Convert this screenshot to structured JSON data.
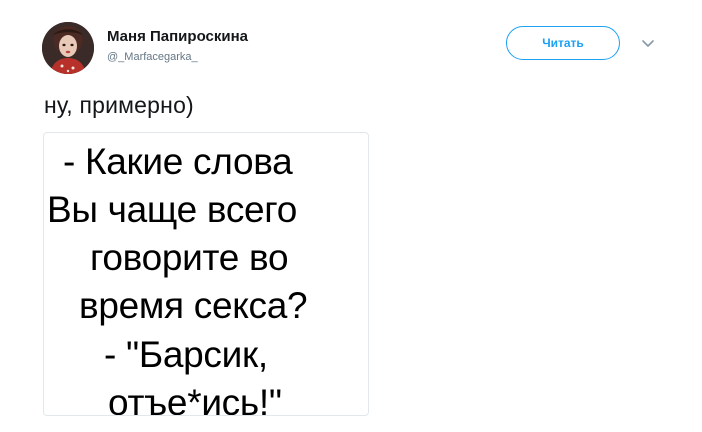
{
  "tweet": {
    "author": {
      "display_name": "Маня Папироскина",
      "username": "@_Marfacegarka_"
    },
    "follow_label": "Читать",
    "text": "ну, примерно)",
    "image_text_lines": [
      "- Какие слова",
      "Вы чаще всего",
      "говорите во",
      "время секса?",
      "- \"Барсик,",
      "отъе*ись!\""
    ]
  },
  "icons": {
    "avatar": "avatar-photo",
    "caret": "chevron-down-icon"
  },
  "colors": {
    "accent": "#1da1f2",
    "text_primary": "#14171a",
    "text_secondary": "#657786",
    "border": "#e1e8ed"
  }
}
